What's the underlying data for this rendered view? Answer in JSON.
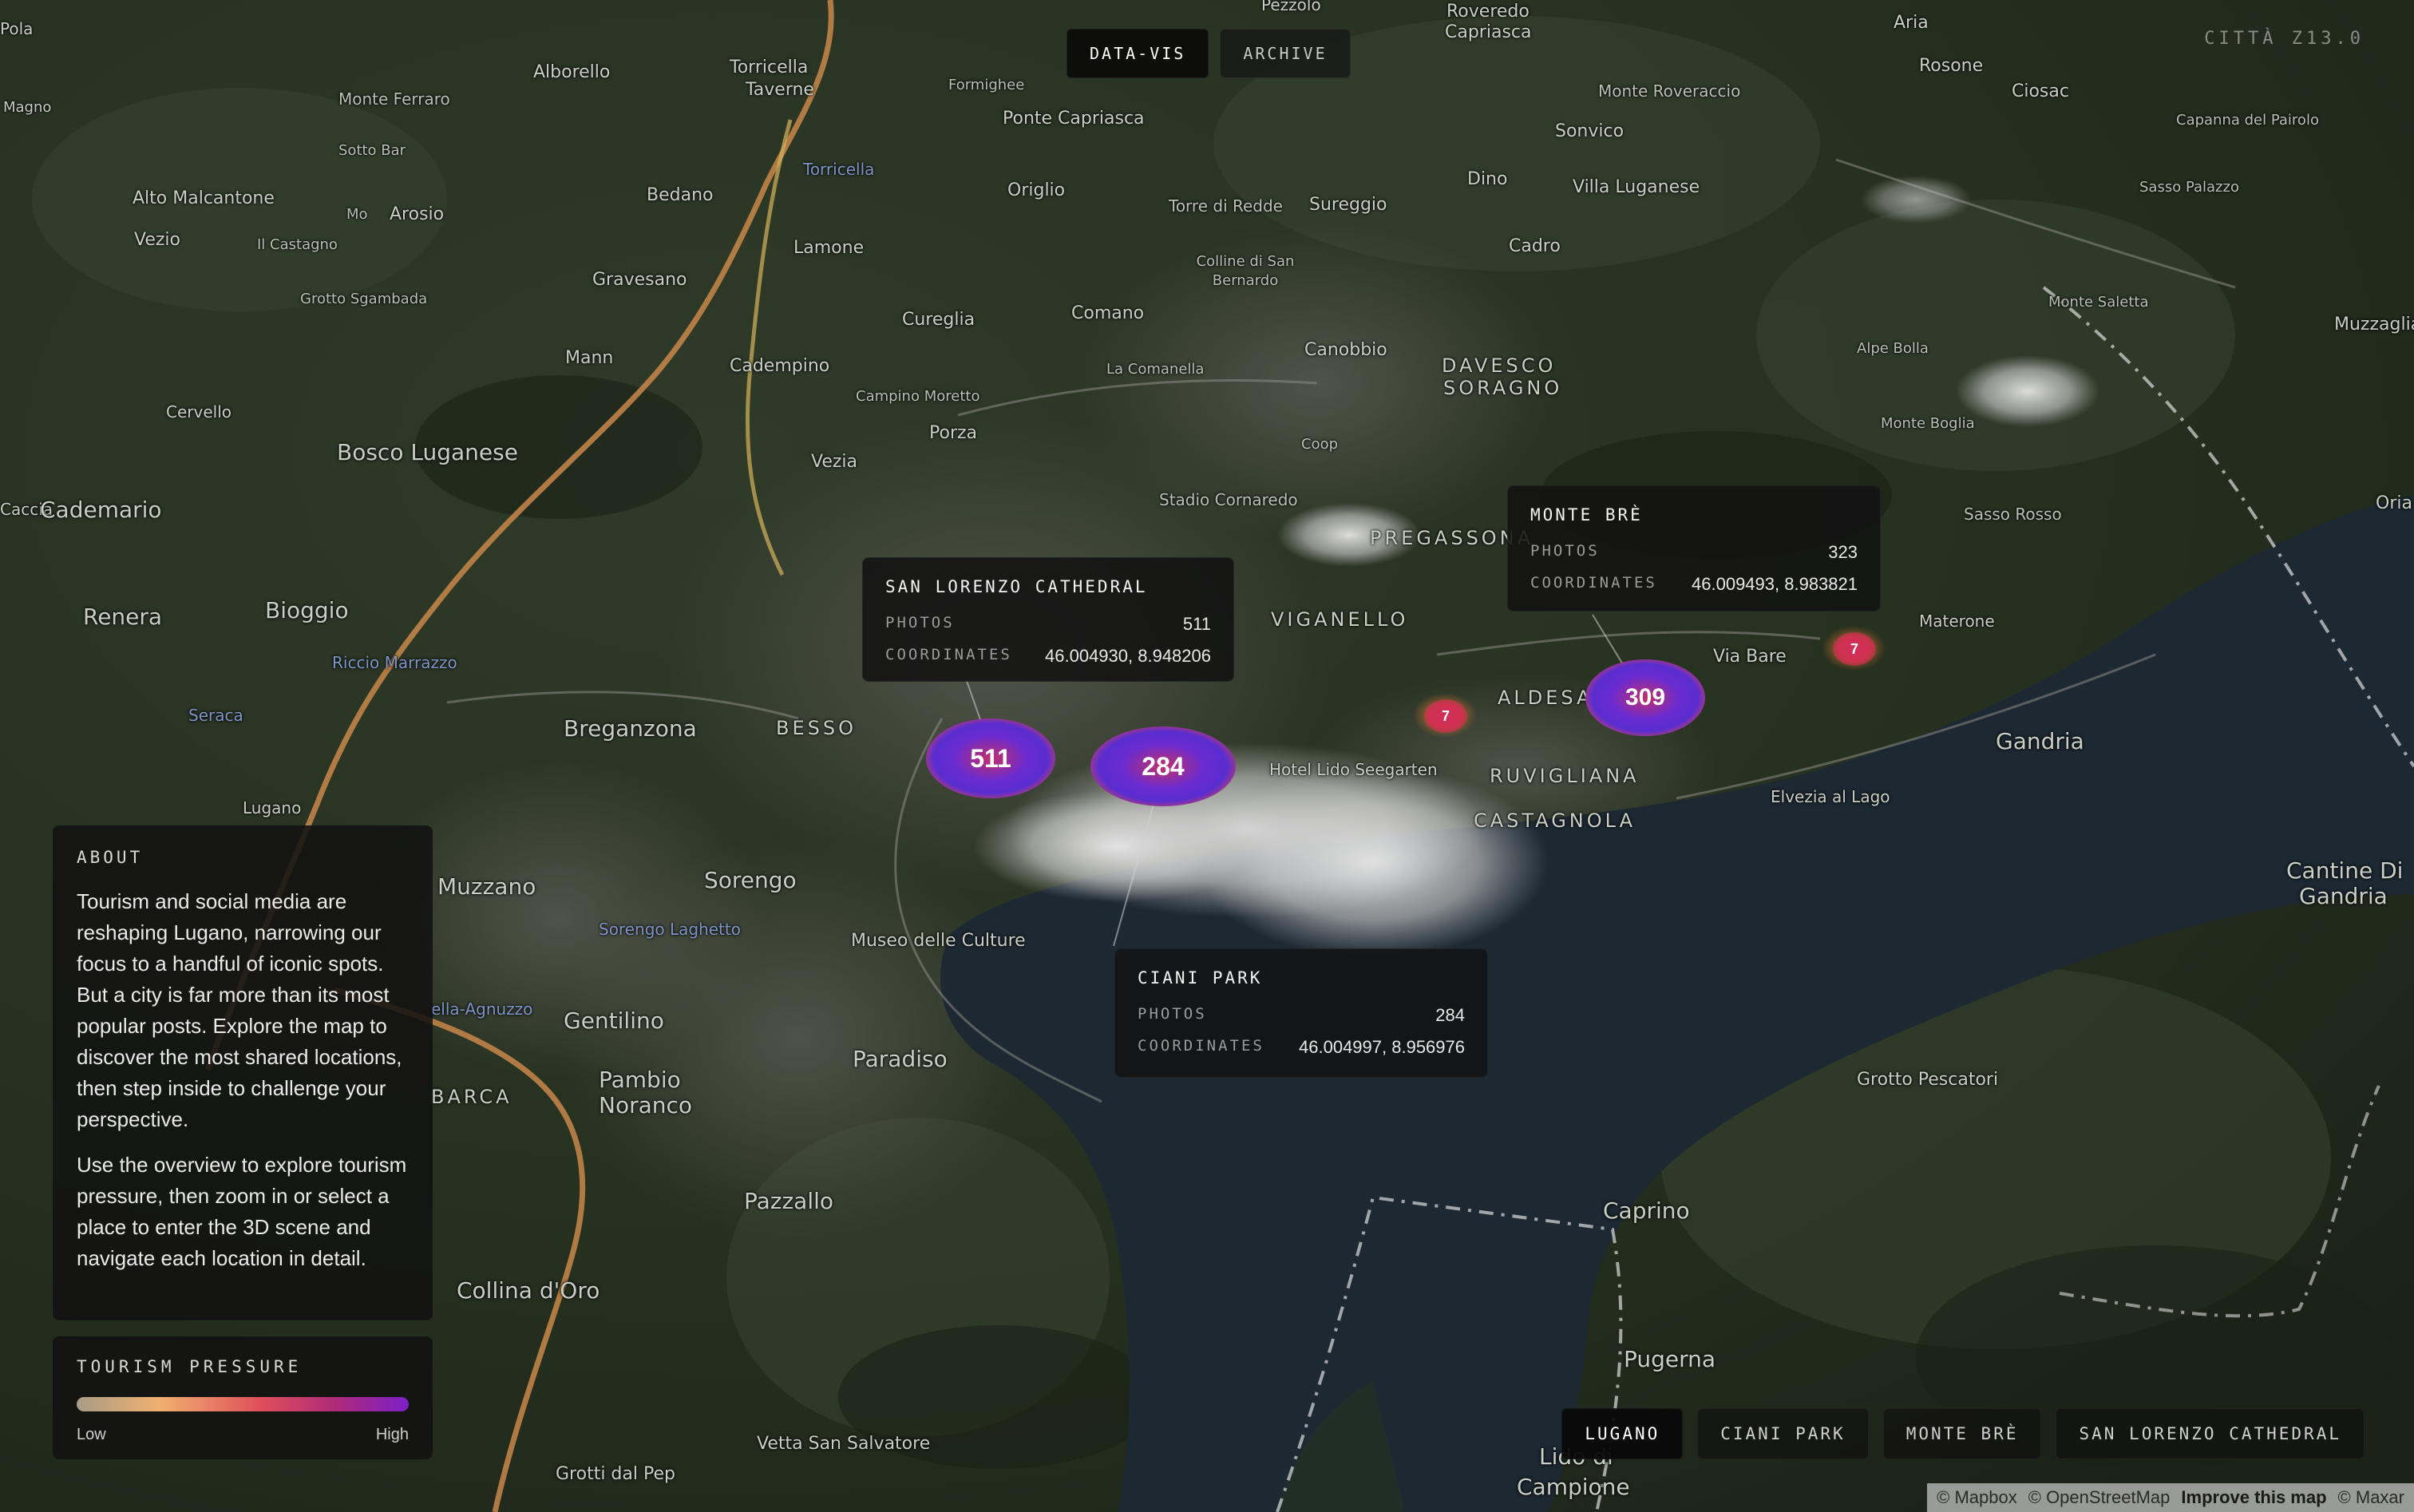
{
  "nav": {
    "items": [
      "DATA-VIS",
      "ARCHIVE"
    ],
    "active": 0
  },
  "zoom_readout": "CITTÀ  Z13.0",
  "places": [
    "Pola",
    "Pezzolo",
    "Roveredo",
    "Capriasca",
    "Aria",
    "Alborello",
    "Torricella",
    "Taverne",
    "Magno",
    "Monte Ferraro",
    "Rosone",
    "Ciosac",
    "Formighee",
    "Ponte Capriasca",
    "Monte Roveraccio",
    "Sotto Bar",
    "Sonvico",
    "Capanna del Pairolo",
    "Alto Malcantone",
    "Bedano",
    "Torricella",
    "Origlio",
    "Dino",
    "Villa Luganese",
    "Sasso Palazzo",
    "Vezio",
    "Arosio",
    "Mo",
    "Torre di Redde",
    "Sureggio",
    "Il Castagno",
    "Lamone",
    "Cadro",
    "Grotto Sgambada",
    "Gravesano",
    "Colline di San Bernardo",
    "Cureglia",
    "Comano",
    "Monte Saletta",
    "Muzzaglia",
    "Mann",
    "Cadempino",
    "La Comanella",
    "Canobbio",
    "DAVESCO",
    "SORAGNO",
    "Alpe Bolla",
    "Cervello",
    "Campino Moretto",
    "Monte Boglia",
    "Bosco Luganese",
    "Porza",
    "Coop",
    "Vezia",
    "Stadio Cornaredo",
    "Sasso Rosso",
    "Caccia",
    "Cademario",
    "PREGASSONA",
    "Oria",
    "Renera",
    "Bioggio",
    "VIGANELLO",
    "Materone",
    "Via Bare",
    "Riccio Marrazzo",
    "ALDESAGO",
    "Seraca",
    "Breganzona",
    "BESSO",
    "Gandria",
    "Lugano",
    "Hotel Lido Seegarten",
    "RUVIGLIANA",
    "Elvezia al Lago",
    "CASTAGNOLA",
    "Cantine Di",
    "Gandria",
    "Muzzano",
    "Sorengo",
    "Sorengo Laghetto",
    "Museo delle Culture",
    "ella-Agnuzzo",
    "Gentilino",
    "Paradiso",
    "Grotto Pescatori",
    "Pambio",
    "Noranco",
    "BARCA",
    "Pazzallo",
    "Caprino",
    "Pugerna",
    "Collina d'Oro",
    "Vetta San Salvatore",
    "Grotti dal Pep",
    "Lido di",
    "Campione"
  ],
  "clusters": [
    {
      "id": "san-lorenzo",
      "count": "511"
    },
    {
      "id": "ciani",
      "count": "284"
    },
    {
      "id": "monte-bre",
      "count": "309"
    },
    {
      "id": "small-a",
      "count": "7"
    },
    {
      "id": "small-b",
      "count": "7"
    }
  ],
  "tooltips": {
    "san_lorenzo": {
      "title": "SAN LORENZO CATHEDRAL",
      "photos_label": "PHOTOS",
      "photos": "511",
      "coords_label": "COORDINATES",
      "coords": "46.004930, 8.948206"
    },
    "monte_bre": {
      "title": "MONTE BRÈ",
      "photos_label": "PHOTOS",
      "photos": "323",
      "coords_label": "COORDINATES",
      "coords": "46.009493, 8.983821"
    },
    "ciani": {
      "title": "CIANI PARK",
      "photos_label": "PHOTOS",
      "photos": "284",
      "coords_label": "COORDINATES",
      "coords": "46.004997, 8.956976"
    }
  },
  "about": {
    "heading": "ABOUT",
    "p1": "Tourism and social media are reshaping Lugano, narrowing our focus to a handful of iconic spots. But a city is far more than its most popular posts. Explore the map to discover the most shared locations, then step inside to challenge your perspective.",
    "p2": "Use the overview to explore tourism pressure, then zoom in or select a place to enter the 3D scene and navigate each location in detail."
  },
  "legend": {
    "title": "TOURISM PRESSURE",
    "low": "Low",
    "high": "High"
  },
  "bottom_nav": {
    "items": [
      "LUGANO",
      "CIANI PARK",
      "MONTE BRÈ",
      "SAN LORENZO CATHEDRAL"
    ],
    "active": 0
  },
  "attribution": {
    "mapbox": "© Mapbox",
    "osm": "© OpenStreetMap",
    "improve": "Improve this map",
    "maxar": "© Maxar"
  },
  "colors": {
    "land": "#2a3424",
    "lake": "#1b2630",
    "cluster_core": "#5a2dd0",
    "cluster_glow": "#e0505a"
  }
}
